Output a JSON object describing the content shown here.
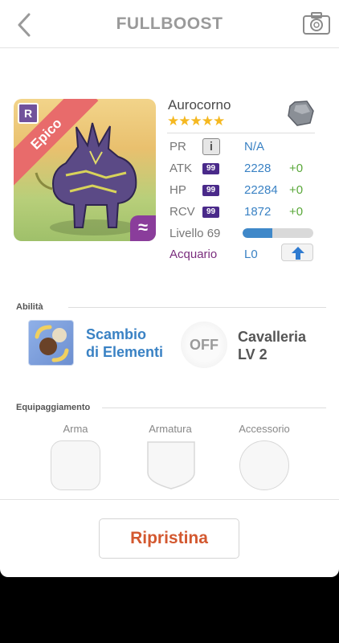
{
  "header": {
    "title": "FULLBOOST",
    "back_icon": "chevron-left-icon",
    "camera_icon": "camera-icon"
  },
  "monster": {
    "name": "Aurocorno",
    "stars": "★★★★★",
    "rarity": "Epico",
    "rarity_badge": "R",
    "element_icon": "rock-element-icon",
    "element_symbol": "≈"
  },
  "stats": {
    "pr_label": "PR",
    "pr_value": "N/A",
    "atk_label": "ATK",
    "atk_badge": "99",
    "atk_value": "2228",
    "atk_plus": "+0",
    "hp_label": "HP",
    "hp_badge": "99",
    "hp_value": "22284",
    "hp_plus": "+0",
    "rcv_label": "RCV",
    "rcv_badge": "99",
    "rcv_value": "1872",
    "rcv_plus": "+0",
    "level_label": "Livello 69",
    "level_progress": 0.42,
    "aquarium_label": "Acquario",
    "aquarium_value": "L0"
  },
  "abilities": {
    "section_title": "Abilità",
    "skill1_line1": "Scambio",
    "skill1_line2": "di Elementi",
    "skill2_status": "OFF",
    "skill2_line1": "Cavalleria",
    "skill2_line2": "LV 2"
  },
  "equipment": {
    "section_title": "Equipaggiamento",
    "weapon_label": "Arma",
    "armor_label": "Armatura",
    "accessory_label": "Accessorio"
  },
  "footer": {
    "reset_label": "Ripristina"
  },
  "colors": {
    "accent_blue": "#3a82c4",
    "plus_green": "#5aa83a",
    "reset_orange": "#d3582f",
    "star_yellow": "#f5b820",
    "rarity_red": "#e86b6b"
  }
}
